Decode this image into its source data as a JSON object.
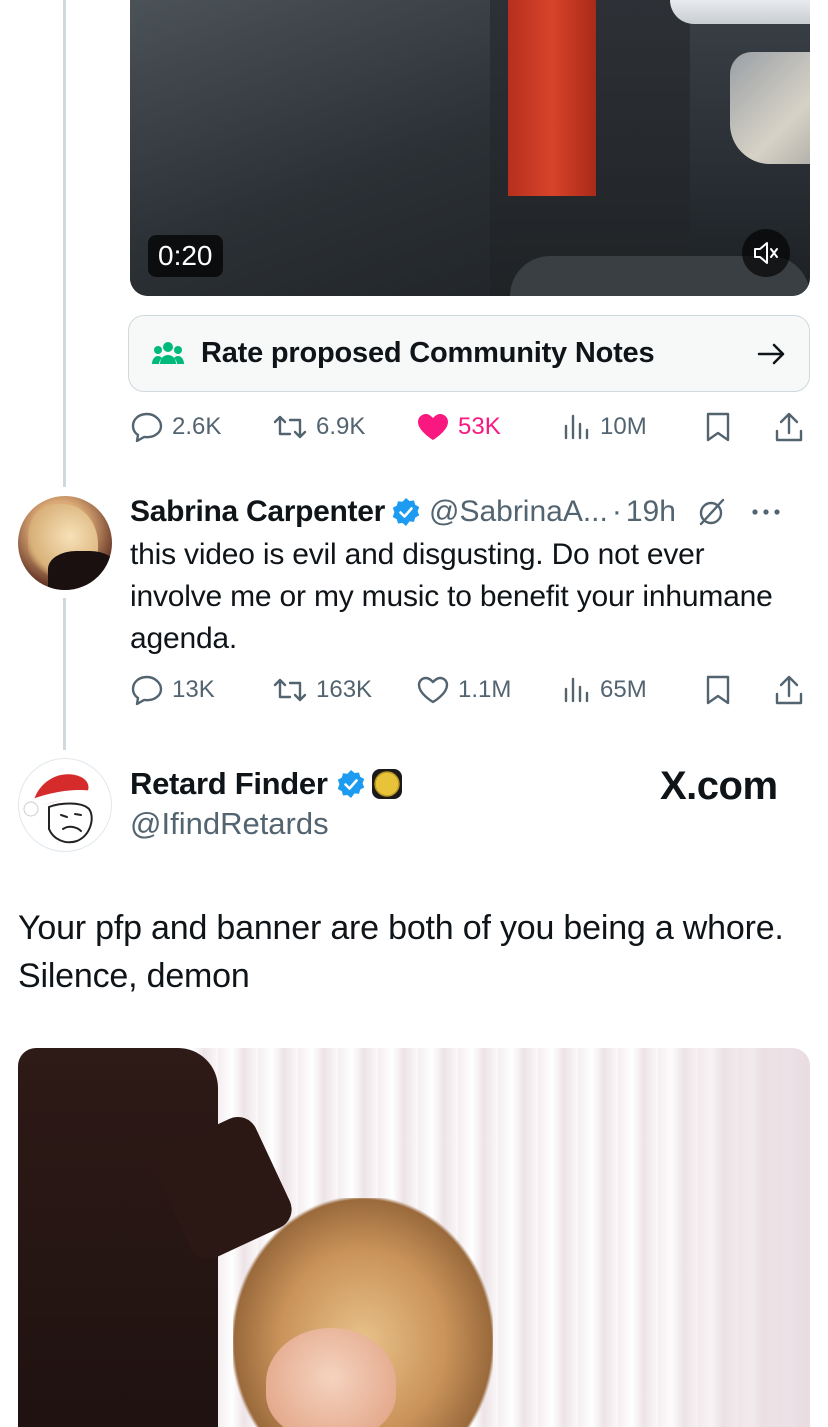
{
  "video": {
    "duration": "0:20",
    "mute_icon": "speaker-muted-icon"
  },
  "community_notes": {
    "label": "Rate proposed Community Notes",
    "icon": "people-icon",
    "arrow_icon": "arrow-right-icon"
  },
  "tweet1_actions": {
    "replies": "2.6K",
    "reposts": "6.9K",
    "likes": "53K",
    "views": "10M",
    "liked": true
  },
  "tweet2": {
    "name": "Sabrina Carpenter",
    "handle": "@SabrinaA...",
    "separator": "·",
    "time": "19h",
    "text": "this video is evil and disgusting. Do not ever involve me or my music to benefit your inhumane agenda.",
    "actions": {
      "replies": "13K",
      "reposts": "163K",
      "likes": "1.1M",
      "views": "65M"
    }
  },
  "tweet3": {
    "name": "Retard Finder",
    "handle": "@IfindRetards",
    "watermark": "X.com",
    "text": "Your pfp and banner are both of you being a whore. Silence, demon"
  },
  "colors": {
    "verified": "#1d9bf0",
    "like": "#f91880",
    "notes_icon": "#00ba7c",
    "muted_text": "#536471",
    "thread_line": "#cfd9de"
  }
}
